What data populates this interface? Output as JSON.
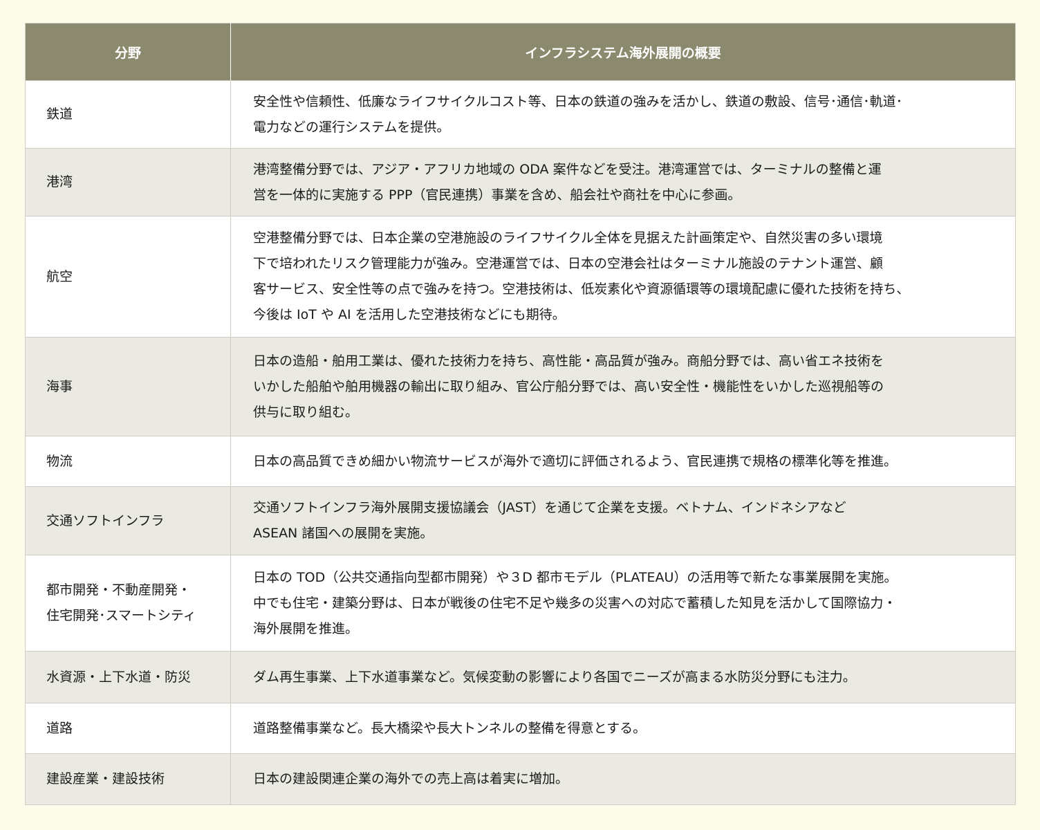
{
  "table": {
    "headers": [
      "分野",
      "インフラシステム海外展開の概要"
    ],
    "rows": [
      {
        "field": "鉄道",
        "desc": "安全性や信頼性、低廉なライフサイクルコスト等、日本の鉄道の強みを活かし、鉄道の敷設、信号･通信･軌道･\n電力などの運行システムを提供。"
      },
      {
        "field": "港湾",
        "desc": "港湾整備分野では、アジア・アフリカ地域の ODA 案件などを受注。港湾運営では、ターミナルの整備と運\n営を一体的に実施する PPP（官民連携）事業を含め、船会社や商社を中心に参画。"
      },
      {
        "field": "航空",
        "desc": "空港整備分野では、日本企業の空港施設のライフサイクル全体を見据えた計画策定や、自然災害の多い環境\n下で培われたリスク管理能力が強み。空港運営では、日本の空港会社はターミナル施設のテナント運営、顧\n客サービス、安全性等の点で強みを持つ。空港技術は、低炭素化や資源循環等の環境配慮に優れた技術を持ち、\n今後は IoT や AI を活用した空港技術などにも期待。"
      },
      {
        "field": "海事",
        "desc": "日本の造船・舶用工業は、優れた技術力を持ち、高性能・高品質が強み。商船分野では、高い省エネ技術を\nいかした船舶や舶用機器の輸出に取り組み、官公庁船分野では、高い安全性・機能性をいかした巡視船等の\n供与に取り組む。"
      },
      {
        "field": "物流",
        "desc": "日本の高品質できめ細かい物流サービスが海外で適切に評価されるよう、官民連携で規格の標準化等を推進。"
      },
      {
        "field": "交通ソフトインフラ",
        "desc": "交通ソフトインフラ海外展開支援協議会（JAST）を通じて企業を支援。ベトナム、インドネシアなど\nASEAN 諸国への展開を実施。"
      },
      {
        "field": "都市開発・不動産開発・\n住宅開発･スマートシティ",
        "desc": "日本の TOD（公共交通指向型都市開発）や３D 都市モデル（PLATEAU）の活用等で新たな事業展開を実施。\n中でも住宅・建築分野は、日本が戦後の住宅不足や幾多の災害への対応で蓄積した知見を活かして国際協力・\n海外展開を推進。"
      },
      {
        "field": "水資源・上下水道・防災",
        "desc": "ダム再生事業、上下水道事業など。気候変動の影響により各国でニーズが高まる水防災分野にも注力。"
      },
      {
        "field": "道路",
        "desc": "道路整備事業など。長大橋梁や長大トンネルの整備を得意とする。"
      },
      {
        "field": "建設産業・建設技術",
        "desc": "日本の建設関連企業の海外での売上高は着実に増加。"
      }
    ]
  }
}
